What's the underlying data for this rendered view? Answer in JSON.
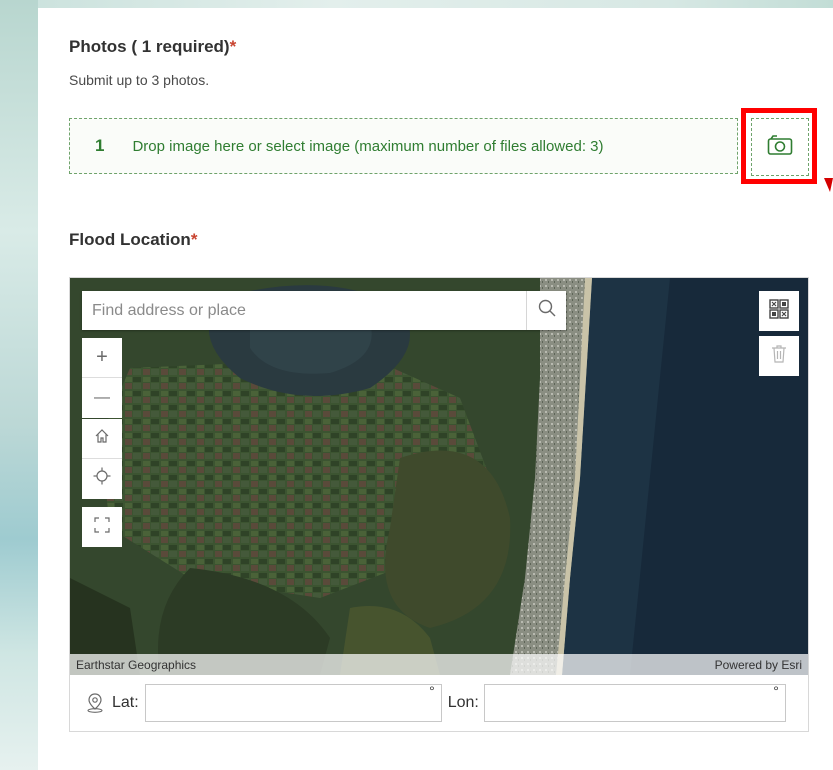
{
  "photos": {
    "title": "Photos ( 1 required)",
    "required_mark": "*",
    "help": "Submit up to 3 photos.",
    "drop_number": "1",
    "drop_text": "Drop image here or select image (maximum number of files allowed: 3)",
    "camera_icon": "camera-icon"
  },
  "location": {
    "title": "Flood Location",
    "required_mark": "*",
    "search_placeholder": "Find address or place",
    "zoom_in": "+",
    "zoom_out": "—",
    "attribution_left": "Earthstar Geographics",
    "attribution_right": "Powered by Esri",
    "lat_label": "Lat:",
    "lon_label": "Lon:",
    "lat_value": "",
    "lon_value": "",
    "degree": "°"
  },
  "colors": {
    "accent_green": "#2f7d31",
    "required_red": "#c8432f",
    "highlight_red": "#ff0000"
  }
}
